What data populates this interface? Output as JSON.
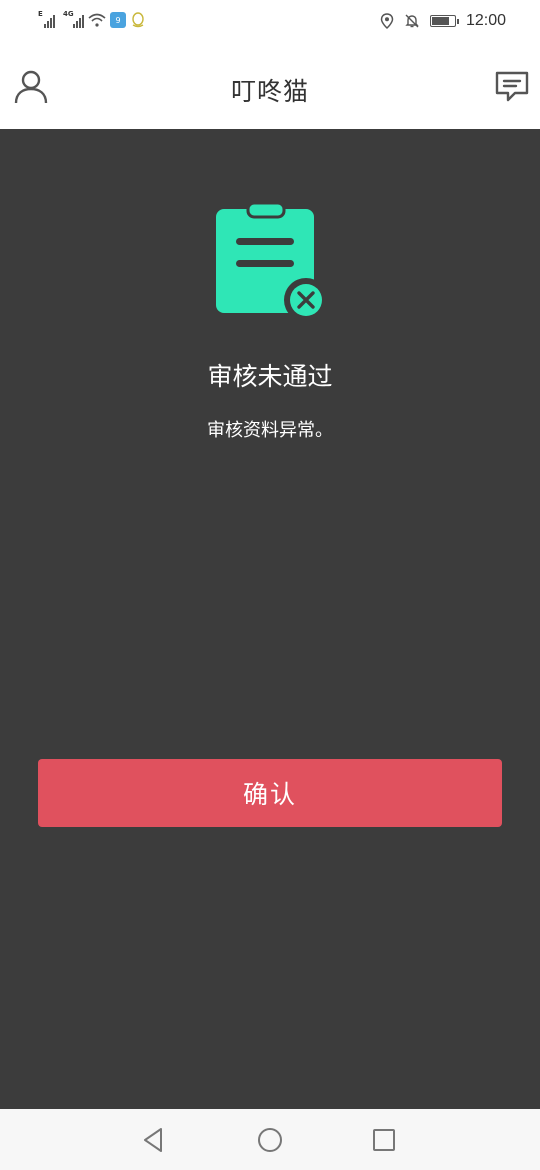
{
  "status_bar": {
    "time": "12:00",
    "network_tags": [
      "E",
      "4G"
    ],
    "icons": [
      "signal-e-icon",
      "signal-4g-icon",
      "wifi-icon",
      "app-notify-icon",
      "qq-icon",
      "location-icon",
      "bell-off-icon",
      "battery-icon"
    ]
  },
  "header": {
    "title": "叮咚猫",
    "left_icon": "user-icon",
    "right_icon": "message-icon"
  },
  "result": {
    "icon": "clipboard-rejected-icon",
    "title": "审核未通过",
    "description": "审核资料异常。"
  },
  "actions": {
    "confirm_label": "确认"
  },
  "nav": {
    "icons": [
      "back-icon",
      "home-icon",
      "recents-icon"
    ]
  },
  "colors": {
    "accent_green": "#2fe6b6",
    "confirm_red": "#e0515e",
    "background": "#3c3c3c"
  }
}
